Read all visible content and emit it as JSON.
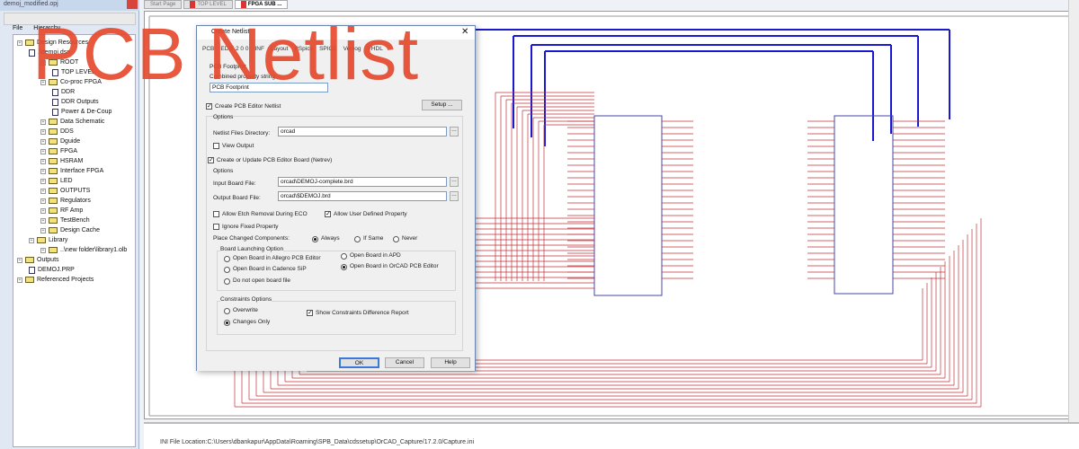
{
  "project_panel": {
    "title": "demoj_modified.opj",
    "tabs": [
      "File",
      "Hierarchy"
    ],
    "tree": [
      {
        "label": "Design Resources",
        "lvl": 0,
        "t": "f"
      },
      {
        "label": ".\\demoj.dsn",
        "lvl": 1,
        "t": "d"
      },
      {
        "label": "ROOT",
        "lvl": 2,
        "t": "f"
      },
      {
        "label": "TOP LEVEL",
        "lvl": 3,
        "t": "d"
      },
      {
        "label": "Co-proc FPGA",
        "lvl": 2,
        "t": "f"
      },
      {
        "label": "DDR",
        "lvl": 3,
        "t": "d"
      },
      {
        "label": "DDR Outputs",
        "lvl": 3,
        "t": "d"
      },
      {
        "label": "Power & De-Coup",
        "lvl": 3,
        "t": "d"
      },
      {
        "label": "Data Schematic",
        "lvl": 2,
        "t": "f"
      },
      {
        "label": "DDS",
        "lvl": 2,
        "t": "f"
      },
      {
        "label": "Dguide",
        "lvl": 2,
        "t": "f"
      },
      {
        "label": "FPGA",
        "lvl": 2,
        "t": "f"
      },
      {
        "label": "HSRAM",
        "lvl": 2,
        "t": "f"
      },
      {
        "label": "Interface FPGA",
        "lvl": 2,
        "t": "f"
      },
      {
        "label": "LED",
        "lvl": 2,
        "t": "f"
      },
      {
        "label": "OUTPUTS",
        "lvl": 2,
        "t": "f"
      },
      {
        "label": "Regulators",
        "lvl": 2,
        "t": "f"
      },
      {
        "label": "RF Amp",
        "lvl": 2,
        "t": "f"
      },
      {
        "label": "TestBench",
        "lvl": 2,
        "t": "f"
      },
      {
        "label": "Design Cache",
        "lvl": 2,
        "t": "f"
      },
      {
        "label": "Library",
        "lvl": 1,
        "t": "f"
      },
      {
        "label": "..\\new folder\\library1.olb",
        "lvl": 2,
        "t": "f"
      },
      {
        "label": "Outputs",
        "lvl": 0,
        "t": "f"
      },
      {
        "label": "DEMOJ.PRP",
        "lvl": 1,
        "t": "d"
      },
      {
        "label": "Referenced Projects",
        "lvl": 0,
        "t": "f"
      }
    ]
  },
  "doc_tabs": [
    {
      "label": "Start Page",
      "active": false
    },
    {
      "label": "TOP LEVEL",
      "active": false
    },
    {
      "label": "FPGA SUB ...",
      "active": true
    }
  ],
  "session_log": "INI File Location:C:\\Users\\dbankapur\\AppData\\Roaming\\SPB_Data\\cdssetup\\OrCAD_Capture/17.2.0/Capture.ini",
  "overlay_title": "PCB Netlist",
  "dialog": {
    "title": "Create Netlist",
    "tabs": [
      "PCB",
      "EDIF 2 0 0",
      "INF",
      "Layout",
      "PSpice",
      "SPICE",
      "Verilog",
      "VHDL"
    ],
    "pcb_footprint_label": "PCB Footprint",
    "combined_label": "Combined property string",
    "combined_value": "PCB Footprint",
    "create_netlist": {
      "label": "Create PCB Editor Netlist",
      "checked": true
    },
    "setup": "Setup ...",
    "options1": "Options",
    "netlist_dir_label": "Netlist Files Directory:",
    "netlist_dir": "orcad",
    "view_output": {
      "label": "View Output",
      "checked": false
    },
    "create_board": {
      "label": "Create or Update PCB Editor Board (Netrev)",
      "checked": true
    },
    "options2": "Options",
    "input_label": "Input Board File:",
    "input_value": "orcad\\DEMOJ-complete.brd",
    "output_label": "Output Board File:",
    "output_value": "orcad\\$DEMOJ.brd",
    "allow_etch": {
      "label": "Allow Etch Removal During ECO",
      "checked": false
    },
    "allow_user": {
      "label": "Allow User Defined Property",
      "checked": true
    },
    "ignore_fixed": {
      "label": "Ignore Fixed Property",
      "checked": false
    },
    "place_label": "Place Changed Components:",
    "place_options": [
      "Always",
      "If Same",
      "Never"
    ],
    "place_selected": "Always",
    "launch_label": "Board Launching Option",
    "launch_options": [
      "Open Board in Allegro PCB Editor",
      "Open Board in Cadence SiP",
      "Do not open board file",
      "Open Board in APD",
      "Open Board in OrCAD PCB Editor"
    ],
    "launch_selected": "Open Board in OrCAD PCB Editor",
    "constraints_label": "Constraints Options",
    "constraint_options": [
      "Overwrite",
      "Changes Only"
    ],
    "constraint_selected": "Changes Only",
    "show_report": {
      "label": "Show Constraints Difference Report",
      "checked": true
    },
    "ok": "OK",
    "cancel": "Cancel",
    "help": "Help"
  },
  "colors": {
    "wire": "#c0303a",
    "bus": "#1a1acc",
    "overlay": "#e64a2e"
  }
}
